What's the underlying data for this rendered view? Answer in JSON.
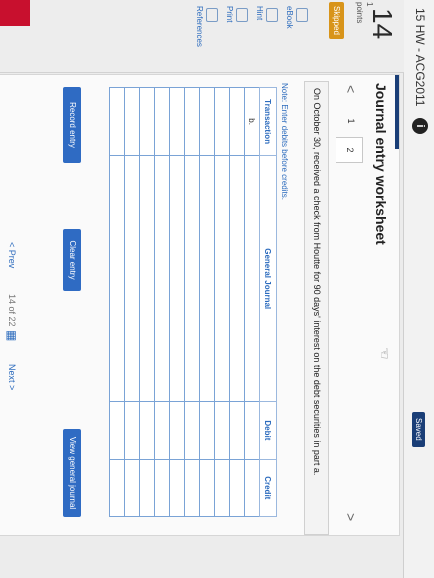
{
  "header": {
    "title": "15 HW - ACG2011",
    "info_glyph": "i",
    "saved_label": "Saved"
  },
  "sidebar": {
    "question_number": "14",
    "points_label": "1\npoints",
    "skipped_label": "Skipped",
    "links": [
      "eBook",
      "Hint",
      "Print",
      "References"
    ]
  },
  "worksheet": {
    "title": "Journal entry worksheet",
    "prev_arrow": "<",
    "next_arrow": ">",
    "pages": [
      "1",
      "2"
    ],
    "description": "On October 30, received a check from Houtte for 90 days' interest on the debt securities in part a.",
    "note": "Note: Enter debits before credits.",
    "columns": [
      "Transaction",
      "General Journal",
      "Debit",
      "Credit"
    ],
    "rows": [
      {
        "transaction": "b."
      },
      {
        "transaction": ""
      },
      {
        "transaction": ""
      },
      {
        "transaction": ""
      },
      {
        "transaction": ""
      },
      {
        "transaction": ""
      },
      {
        "transaction": ""
      },
      {
        "transaction": ""
      },
      {
        "transaction": ""
      },
      {
        "transaction": ""
      }
    ],
    "buttons": {
      "record": "Record entry",
      "clear": "Clear entry",
      "view": "View general journal"
    }
  },
  "footer": {
    "prev": "< Prev",
    "position": "14 of 22",
    "next": "Next >"
  }
}
